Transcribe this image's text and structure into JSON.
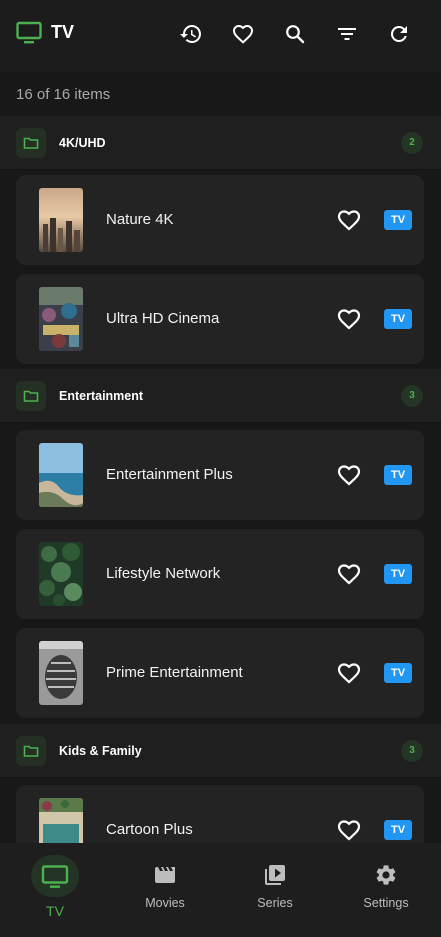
{
  "app": {
    "title": "TV"
  },
  "toolbar": {
    "actions": [
      {
        "name": "history-icon"
      },
      {
        "name": "favorite-icon"
      },
      {
        "name": "search-icon"
      },
      {
        "name": "filter-icon"
      },
      {
        "name": "refresh-icon"
      }
    ]
  },
  "item_count": "16 of 16 items",
  "colors": {
    "accent": "#4caf50",
    "badge": "#2196f3",
    "background": "#181818",
    "card": "#232323"
  },
  "categories": [
    {
      "name": "4K/UHD",
      "count": "2",
      "channels": [
        {
          "name": "Nature 4K",
          "badge": "TV",
          "thumbnail": "city-sunset"
        },
        {
          "name": "Ultra HD Cinema",
          "badge": "TV",
          "thumbnail": "street-festival"
        }
      ]
    },
    {
      "name": "Entertainment",
      "count": "3",
      "channels": [
        {
          "name": "Entertainment Plus",
          "badge": "TV",
          "thumbnail": "coast-cliffs"
        },
        {
          "name": "Lifestyle Network",
          "badge": "TV",
          "thumbnail": "green-leaves"
        },
        {
          "name": "Prime Entertainment",
          "badge": "TV",
          "thumbnail": "bw-pinecone"
        }
      ]
    },
    {
      "name": "Kids & Family",
      "count": "3",
      "channels": [
        {
          "name": "Cartoon Plus",
          "badge": "TV",
          "thumbnail": "garden-room"
        }
      ]
    }
  ],
  "bottom_nav": [
    {
      "label": "TV",
      "icon": "tv-icon",
      "active": true
    },
    {
      "label": "Movies",
      "icon": "movie-icon",
      "active": false
    },
    {
      "label": "Series",
      "icon": "series-icon",
      "active": false
    },
    {
      "label": "Settings",
      "icon": "gear-icon",
      "active": false
    }
  ]
}
